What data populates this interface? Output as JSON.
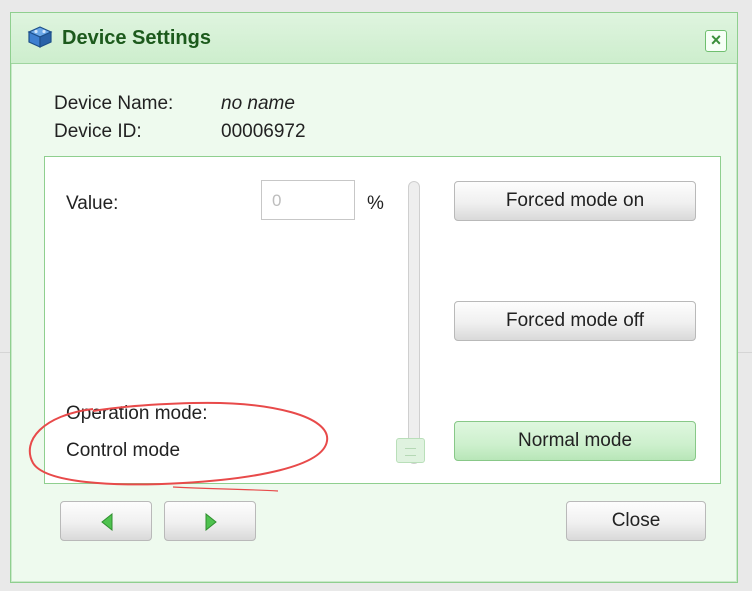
{
  "dialog": {
    "title": "Device Settings",
    "title_icon": "cube-icon",
    "close_icon": "close-x-icon"
  },
  "device": {
    "name_label": "Device Name:",
    "name_value": "no name",
    "id_label": "Device ID:",
    "id_value": "00006972"
  },
  "control": {
    "value_label": "Value:",
    "value_input": "0",
    "unit": "%",
    "slider_level": 0,
    "forced_on_label": "Forced mode on",
    "forced_off_label": "Forced mode off",
    "normal_label": "Normal mode",
    "operation_mode_label": "Operation mode:",
    "control_mode_label": "Control mode"
  },
  "footer": {
    "prev_icon": "arrow-left-icon",
    "next_icon": "arrow-right-icon",
    "close_label": "Close"
  },
  "colors": {
    "accent_green": "#1c5a1c",
    "annotation_red": "#e84a4a"
  }
}
